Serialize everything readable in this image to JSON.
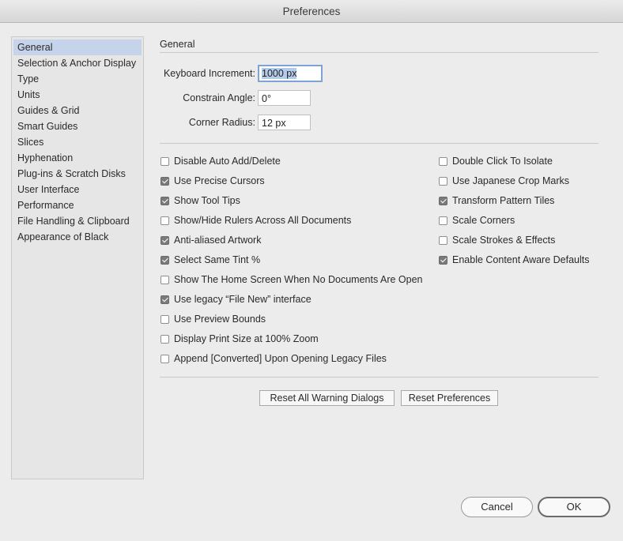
{
  "window": {
    "title": "Preferences"
  },
  "sidebar": {
    "selected_index": 0,
    "items": [
      "General",
      "Selection & Anchor Display",
      "Type",
      "Units",
      "Guides & Grid",
      "Smart Guides",
      "Slices",
      "Hyphenation",
      "Plug-ins & Scratch Disks",
      "User Interface",
      "Performance",
      "File Handling & Clipboard",
      "Appearance of Black"
    ]
  },
  "general": {
    "section_title": "General",
    "keyboard_increment": {
      "label": "Keyboard Increment:",
      "value": "1000 px"
    },
    "constrain_angle": {
      "label": "Constrain Angle:",
      "value": "0°"
    },
    "corner_radius": {
      "label": "Corner Radius:",
      "value": "12 px"
    },
    "left_options": [
      {
        "label": "Disable Auto Add/Delete",
        "checked": false
      },
      {
        "label": "Use Precise Cursors",
        "checked": true
      },
      {
        "label": "Show Tool Tips",
        "checked": true
      },
      {
        "label": "Show/Hide Rulers Across All Documents",
        "checked": false
      },
      {
        "label": "Anti-aliased Artwork",
        "checked": true
      },
      {
        "label": "Select Same Tint %",
        "checked": true
      },
      {
        "label": "Show The Home Screen When No Documents Are Open",
        "checked": false
      },
      {
        "label": "Use legacy “File New” interface",
        "checked": true
      },
      {
        "label": "Use Preview Bounds",
        "checked": false
      },
      {
        "label": "Display Print Size at 100% Zoom",
        "checked": false
      },
      {
        "label": "Append [Converted] Upon Opening Legacy Files",
        "checked": false
      }
    ],
    "right_options": [
      {
        "label": "Double Click To Isolate",
        "checked": false
      },
      {
        "label": "Use Japanese Crop Marks",
        "checked": false
      },
      {
        "label": "Transform Pattern Tiles",
        "checked": true
      },
      {
        "label": "Scale Corners",
        "checked": false
      },
      {
        "label": "Scale Strokes & Effects",
        "checked": false
      },
      {
        "label": "Enable Content Aware Defaults",
        "checked": true
      }
    ],
    "reset_warnings_label": "Reset All Warning Dialogs",
    "reset_prefs_label": "Reset Preferences"
  },
  "footer": {
    "cancel_label": "Cancel",
    "ok_label": "OK"
  }
}
